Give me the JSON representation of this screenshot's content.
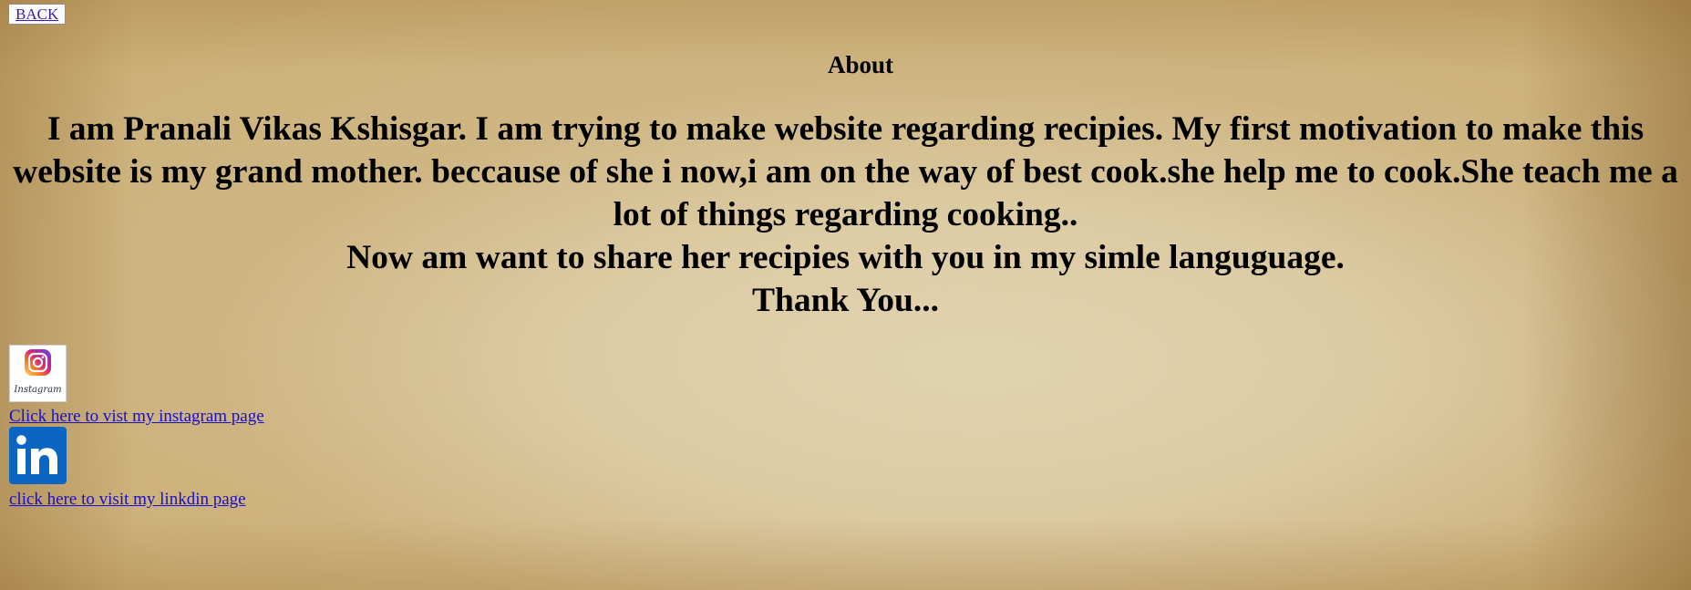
{
  "nav": {
    "back_label": "BACK"
  },
  "about": {
    "title": "About",
    "lines": [
      "I am Pranali Vikas Kshisgar. I am trying to make website regarding recipies. My first motivation to make this website is my grand mother. beccause of she i now,i am on the way of best cook.she help me to cook.She teach me a lot of things regarding cooking..",
      "Now am want to share her recipies with you in my simle languguage.",
      "Thank You..."
    ]
  },
  "social": {
    "instagram": {
      "icon": "instagram-icon",
      "icon_caption": "Instagram",
      "link_text": "Click here to vist my instagram page"
    },
    "linkedin": {
      "icon": "linkedin-icon",
      "link_text": "click here to visit my linkdin page"
    }
  },
  "colors": {
    "link": "#1a0dcc",
    "linkedin_brand": "#0a66c2"
  }
}
